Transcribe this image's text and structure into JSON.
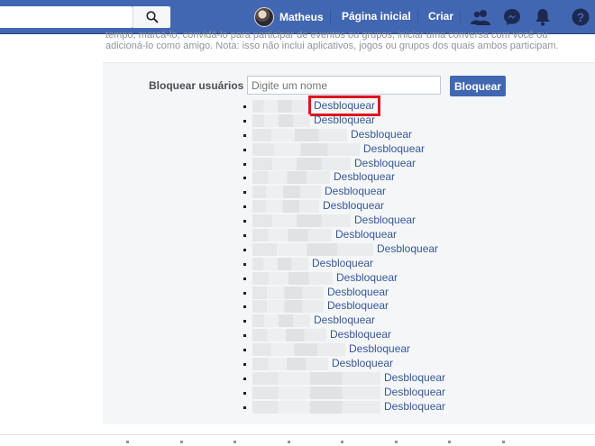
{
  "topbar": {
    "user_name": "Matheus",
    "home_label": "Página inicial",
    "create_label": "Criar"
  },
  "intro": {
    "line1": "tempo, marcá-lo, convidá-lo para participar de eventos ou grupos, iniciar uma conversa com você ou",
    "line2": "adicioná-lo como amigo. Nota: isso não inclui aplicativos, jogos ou grupos dos quais ambos participam."
  },
  "block": {
    "label": "Bloquear usuários",
    "input_placeholder": "Digite um nome",
    "button_label": "Bloquear"
  },
  "blocked_users": {
    "unblock_label": "Desbloquear",
    "count": 22,
    "highlighted_index": 0
  },
  "colors": {
    "brand": "#4267b2",
    "link": "#365899",
    "highlight": "#e0141e"
  }
}
